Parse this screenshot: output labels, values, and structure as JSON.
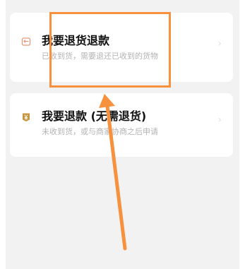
{
  "options": [
    {
      "title": "我要退货退款",
      "description": "已收到货，需要退还已收到的货物",
      "icon": "return-box-icon"
    },
    {
      "title": "我要退款 (无需退货)",
      "description": "未收到货，或与商家协商之后申请",
      "icon": "refund-yen-icon"
    }
  ],
  "colors": {
    "annotation": "#f7913d",
    "icon_accent": "#e39a7a",
    "icon_gold": "#c7953f"
  }
}
